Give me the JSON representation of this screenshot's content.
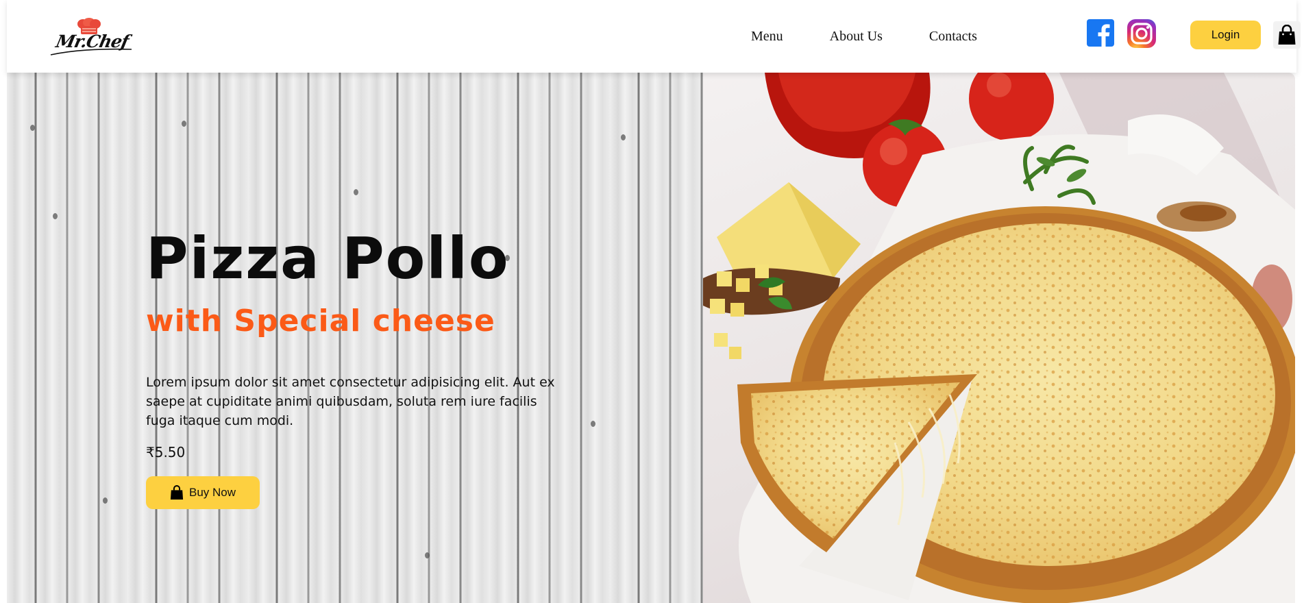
{
  "header": {
    "logo_text": "Mr.Chef",
    "nav": [
      {
        "label": "Menu"
      },
      {
        "label": "About Us"
      },
      {
        "label": "Contacts"
      }
    ],
    "social": [
      {
        "icon": "facebook-icon",
        "color": "#1877f2"
      },
      {
        "icon": "instagram-icon",
        "color": "#d62976"
      }
    ],
    "login_label": "Login",
    "cart_icon": "shopping-bag-icon"
  },
  "hero": {
    "title": "Pizza Pollo",
    "subtitle": "with Special cheese",
    "description": "Lorem ipsum dolor sit amet consectetur adipisicing elit. Aut ex saepe at cupiditate animi quibusdam, soluta rem iure facilis fuga itaque cum modi.",
    "price": "₹5.50",
    "buy_label": "Buy Now",
    "buy_icon": "shopping-bag-icon",
    "image": "pizza-with-cheese-and-tomatoes"
  },
  "colors": {
    "accent_yellow": "#fdd040",
    "subtitle_orange": "#fb5a17",
    "text_dark": "#111111"
  }
}
